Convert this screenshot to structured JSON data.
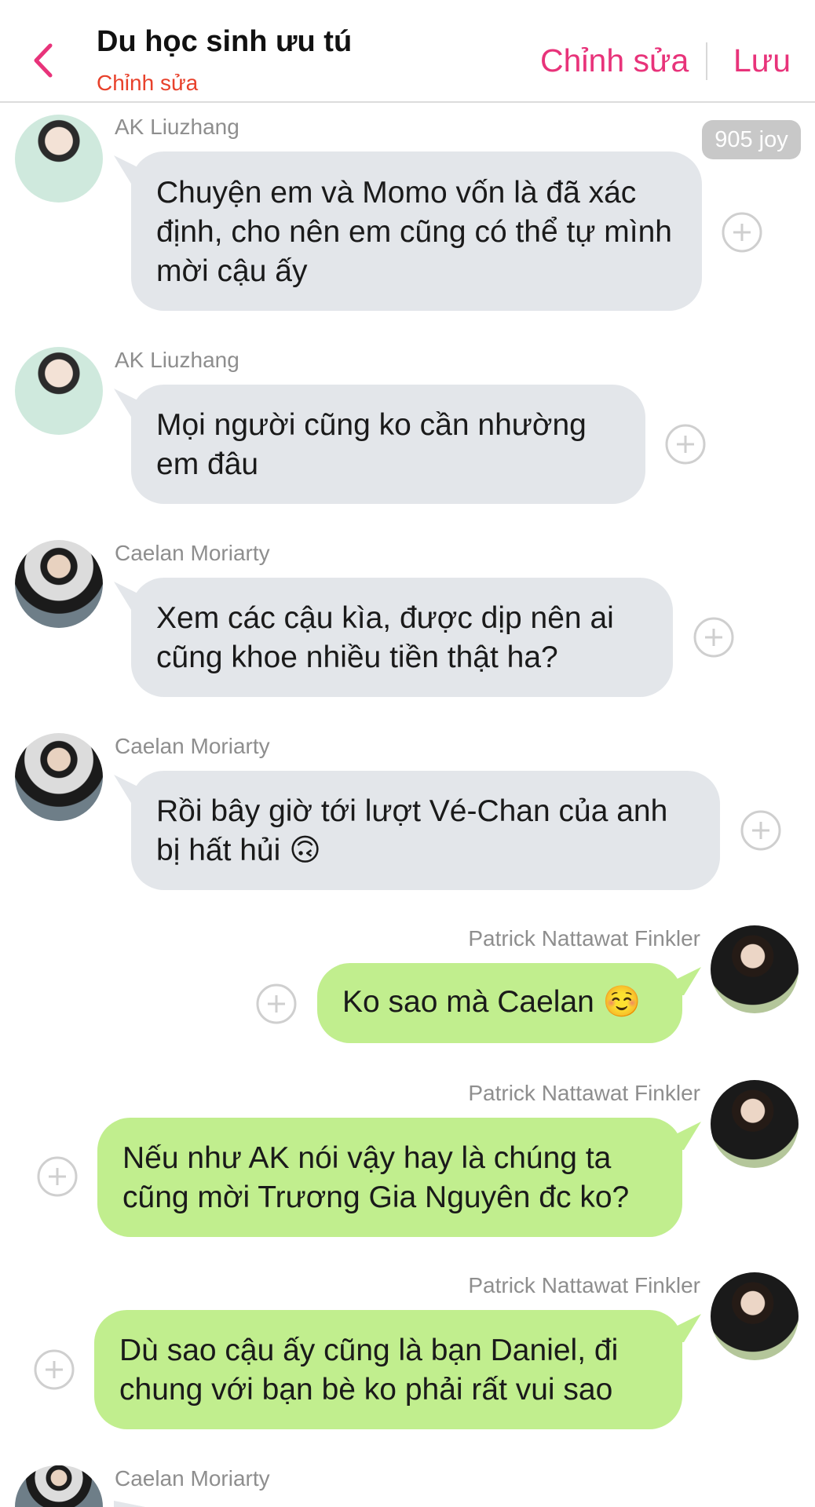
{
  "header": {
    "title": "Du học sinh ưu tú",
    "subtitle": "Chỉnh sửa",
    "edit_label": "Chỉnh sửa",
    "save_label": "Lưu"
  },
  "badge": {
    "text": "905 joy"
  },
  "messages": [
    {
      "sender": "AK Liuzhang",
      "text": "Chuyện em và Momo vốn là đã xác định, cho nên em cũng có thể tự mình mời cậu ấy",
      "side": "left"
    },
    {
      "sender": "AK Liuzhang",
      "text": "Mọi người cũng ko cần nhường em đâu",
      "side": "left"
    },
    {
      "sender": "Caelan Moriarty",
      "text": "Xem các cậu kìa, được dịp nên ai cũng khoe nhiều tiền thật ha?",
      "side": "left"
    },
    {
      "sender": "Caelan Moriarty",
      "text": "Rồi bây giờ tới lượt Vé-Chan của anh bị hất hủi 🙃",
      "side": "left"
    },
    {
      "sender": "Patrick Nattawat Finkler",
      "text": "Ko sao mà Caelan ☺️",
      "side": "right"
    },
    {
      "sender": "Patrick Nattawat Finkler",
      "text": "Nếu như AK nói vậy hay là chúng ta cũng mời Trương Gia Nguyên đc ko?",
      "side": "right"
    },
    {
      "sender": "Patrick Nattawat Finkler",
      "text": "Dù sao cậu ấy cũng là bạn Daniel, đi chung với bạn bè ko phải rất vui sao",
      "side": "right"
    },
    {
      "sender": "Caelan Moriarty",
      "text": "",
      "side": "left"
    }
  ],
  "colors": {
    "accent": "#e8337a",
    "subtitle": "#e8412b",
    "gray_bubble": "#e3e6ea",
    "green_bubble": "#c1ee8e"
  }
}
